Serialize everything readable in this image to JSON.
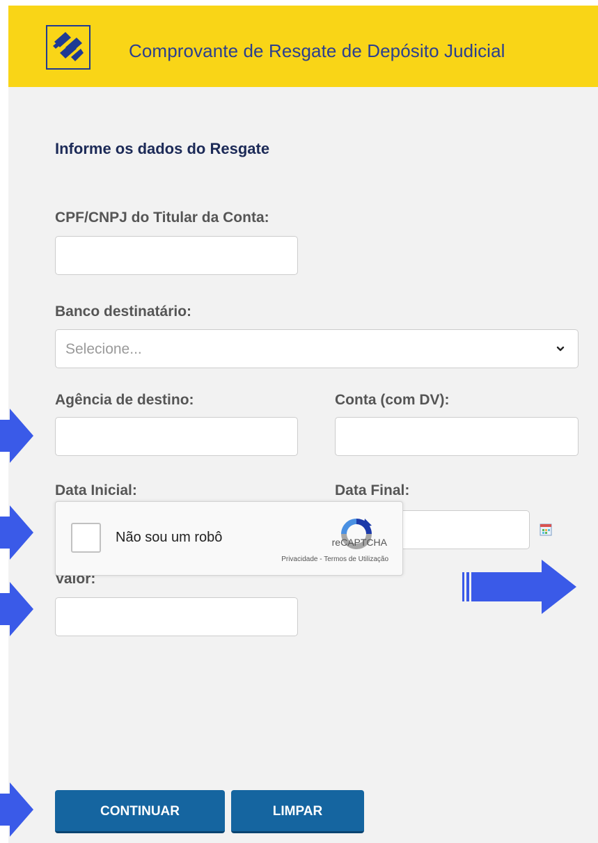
{
  "header": {
    "title": "Comprovante de Resgate de Depósito Judicial",
    "brand_color": "#f9d517",
    "title_color": "#2b3f8f"
  },
  "form": {
    "section_title": "Informe os dados do Resgate",
    "cpf_cnpj": {
      "label": "CPF/CNPJ do Titular da Conta:",
      "value": ""
    },
    "banco": {
      "label": "Banco destinatário:",
      "placeholder": "Selecione..."
    },
    "agencia": {
      "label": "Agência de destino:",
      "value": ""
    },
    "conta": {
      "label": "Conta (com DV):",
      "value": ""
    },
    "data_inicial": {
      "label": "Data Inicial:",
      "value": ""
    },
    "data_final": {
      "label": "Data Final:",
      "value": ""
    },
    "valor": {
      "label": "Valor:",
      "value": ""
    }
  },
  "recaptcha": {
    "label": "Não sou um robô",
    "brand": "reCAPTCHA",
    "privacy": "Privacidade",
    "separator": " - ",
    "terms": "Termos de Utilização",
    "checked": false
  },
  "buttons": {
    "continue_label": "CONTINUAR",
    "clear_label": "LIMPAR",
    "color": "#1565a0"
  },
  "annotations": {
    "arrow_color": "#3a5ae8",
    "icon_names": [
      "arrow-right-icon",
      "arrow-right-icon",
      "arrow-right-icon",
      "arrow-right-icon",
      "arrow-right-icon"
    ]
  }
}
